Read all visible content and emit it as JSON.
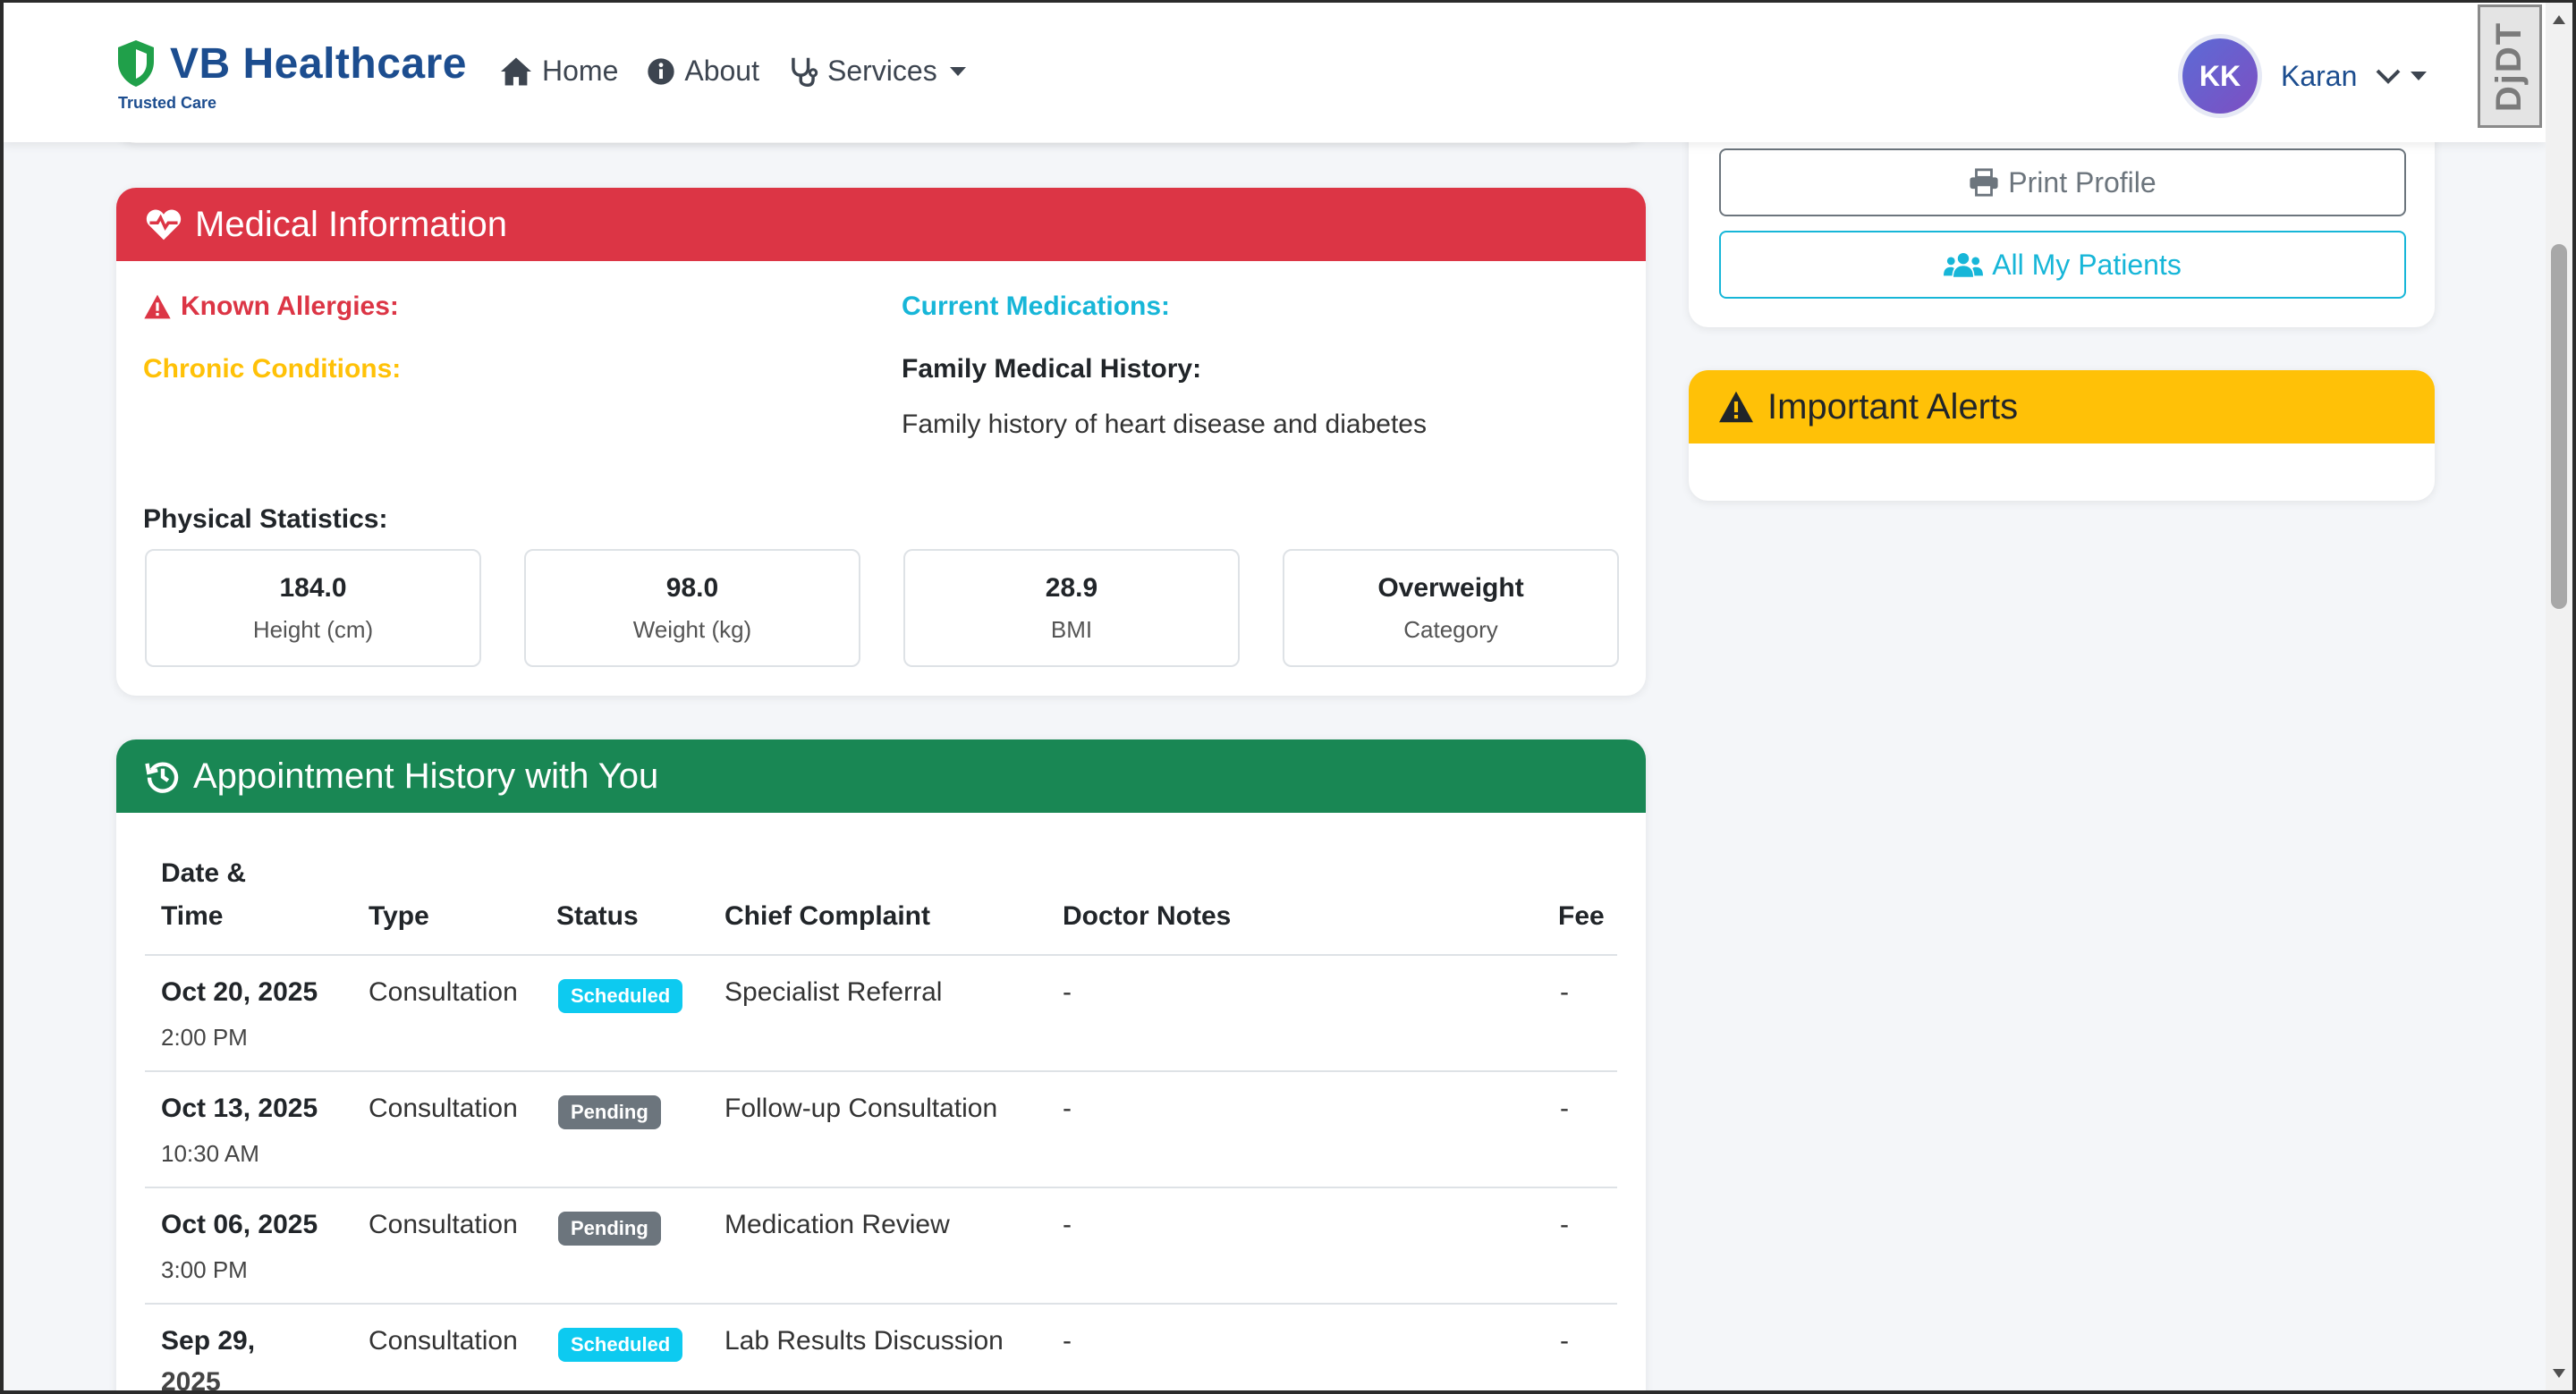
{
  "brand": {
    "name": "VB Healthcare",
    "tagline": "Trusted Care"
  },
  "nav": {
    "home": "Home",
    "about": "About",
    "services": "Services"
  },
  "user": {
    "initials": "KK",
    "name": "Karan"
  },
  "debug_toolbar": "DjDT",
  "side": {
    "print_label": "Print Profile",
    "patients_label": "All My Patients",
    "alerts_title": "Important Alerts"
  },
  "medical": {
    "title": "Medical Information",
    "allergies_label": "Known Allergies:",
    "chronic_label": "Chronic Conditions:",
    "medications_label": "Current Medications:",
    "family_label": "Family Medical History:",
    "family_text": "Family history of heart disease and diabetes",
    "physical_label": "Physical Statistics:",
    "stats": [
      {
        "value": "184.0",
        "label": "Height (cm)"
      },
      {
        "value": "98.0",
        "label": "Weight (kg)"
      },
      {
        "value": "28.9",
        "label": "BMI"
      },
      {
        "value": "Overweight",
        "label": "Category"
      }
    ]
  },
  "appointments": {
    "title": "Appointment History with You",
    "headers": {
      "date_line1": "Date &",
      "date_line2": "Time",
      "type": "Type",
      "status": "Status",
      "complaint": "Chief Complaint",
      "notes": "Doctor Notes",
      "fee": "Fee"
    },
    "rows": [
      {
        "date": "Oct 20, 2025",
        "time": "2:00 PM",
        "type": "Consultation",
        "status": "Scheduled",
        "complaint": "Specialist Referral",
        "notes": "-",
        "fee": "-"
      },
      {
        "date": "Oct 13, 2025",
        "time": "10:30 AM",
        "type": "Consultation",
        "status": "Pending",
        "complaint": "Follow-up Consultation",
        "notes": "-",
        "fee": "-"
      },
      {
        "date": "Oct 06, 2025",
        "time": "3:00 PM",
        "type": "Consultation",
        "status": "Pending",
        "complaint": "Medication Review",
        "notes": "-",
        "fee": "-"
      },
      {
        "date": "Sep 29,",
        "time": "2025",
        "type": "Consultation",
        "status": "Scheduled",
        "complaint": "Lab Results Discussion",
        "notes": "-",
        "fee": "-"
      }
    ]
  },
  "colors": {
    "brand": "#1c4d8f",
    "danger": "#dc3545",
    "success": "#198754",
    "warning": "#ffc107",
    "info": "#0dcaf0",
    "secondary": "#6c757d"
  }
}
